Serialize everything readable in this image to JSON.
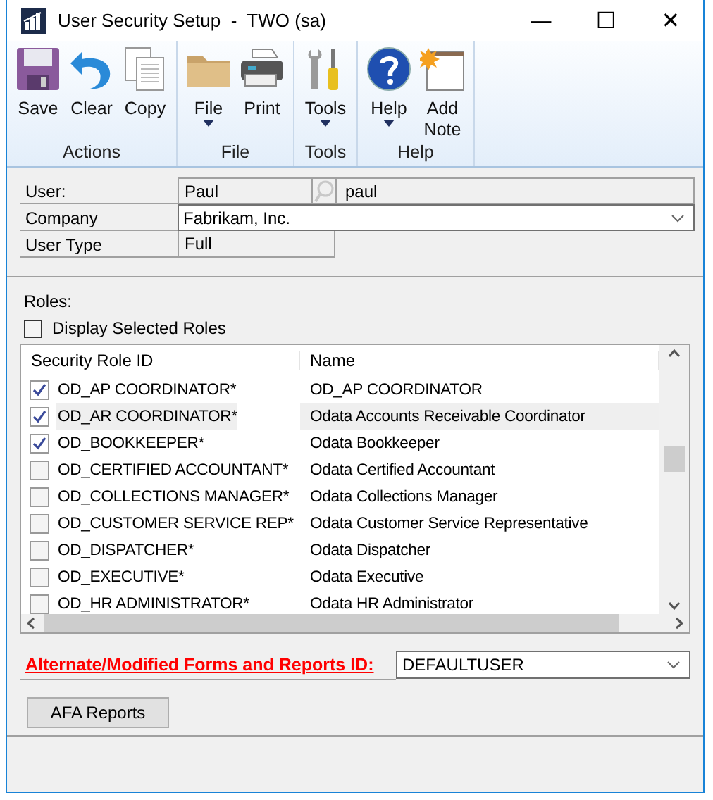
{
  "window": {
    "title": "User Security Setup  -  TWO (sa)",
    "controls": [
      "—",
      "☐",
      "✕"
    ]
  },
  "ribbon": {
    "groups": [
      {
        "label": "Actions",
        "buttons": [
          {
            "kind": "save",
            "label": "Save",
            "dropdown": false
          },
          {
            "kind": "clear",
            "label": "Clear",
            "dropdown": false
          },
          {
            "kind": "copy",
            "label": "Copy",
            "dropdown": false
          }
        ]
      },
      {
        "label": "File",
        "buttons": [
          {
            "kind": "folder",
            "label": "File",
            "dropdown": true
          },
          {
            "kind": "print",
            "label": "Print",
            "dropdown": false
          }
        ]
      },
      {
        "label": "Tools",
        "buttons": [
          {
            "kind": "tools",
            "label": "Tools",
            "dropdown": true
          }
        ]
      },
      {
        "label": "Help",
        "buttons": [
          {
            "kind": "help",
            "label": "Help",
            "dropdown": true
          },
          {
            "kind": "note",
            "label": "Add Note",
            "dropdown": false
          }
        ]
      }
    ]
  },
  "form": {
    "user_label": "User:",
    "user_id": "Paul",
    "user_name": "paul",
    "company_label": "Company",
    "company": "Fabrikam, Inc.",
    "user_type_label": "User Type",
    "user_type": "Full"
  },
  "roles": {
    "label": "Roles:",
    "display_selected": {
      "label": "Display Selected Roles",
      "checked": false
    },
    "columns": [
      "Security Role ID",
      "Name"
    ],
    "rows": [
      {
        "id": "OD_AP COORDINATOR*",
        "name": "OD_AP COORDINATOR",
        "checked": true,
        "selected": false
      },
      {
        "id": "OD_AR COORDINATOR*",
        "name": "Odata Accounts Receivable Coordinator",
        "checked": true,
        "selected": true
      },
      {
        "id": "OD_BOOKKEEPER*",
        "name": "Odata Bookkeeper",
        "checked": true,
        "selected": false
      },
      {
        "id": "OD_CERTIFIED ACCOUNTANT*",
        "name": "Odata Certified Accountant",
        "checked": false,
        "selected": false
      },
      {
        "id": "OD_COLLECTIONS MANAGER*",
        "name": "Odata Collections Manager",
        "checked": false,
        "selected": false
      },
      {
        "id": "OD_CUSTOMER SERVICE REP*",
        "name": "Odata Customer Service Representative",
        "checked": false,
        "selected": false
      },
      {
        "id": "OD_DISPATCHER*",
        "name": "Odata Dispatcher",
        "checked": false,
        "selected": false
      },
      {
        "id": "OD_EXECUTIVE*",
        "name": "Odata Executive",
        "checked": false,
        "selected": false
      },
      {
        "id": "OD_HR ADMINISTRATOR*",
        "name": "Odata HR Administrator",
        "checked": false,
        "selected": false
      }
    ]
  },
  "afa": {
    "label": "Alternate/Modified Forms and Reports ID:",
    "value": "DEFAULTUSER",
    "button": "AFA Reports"
  }
}
